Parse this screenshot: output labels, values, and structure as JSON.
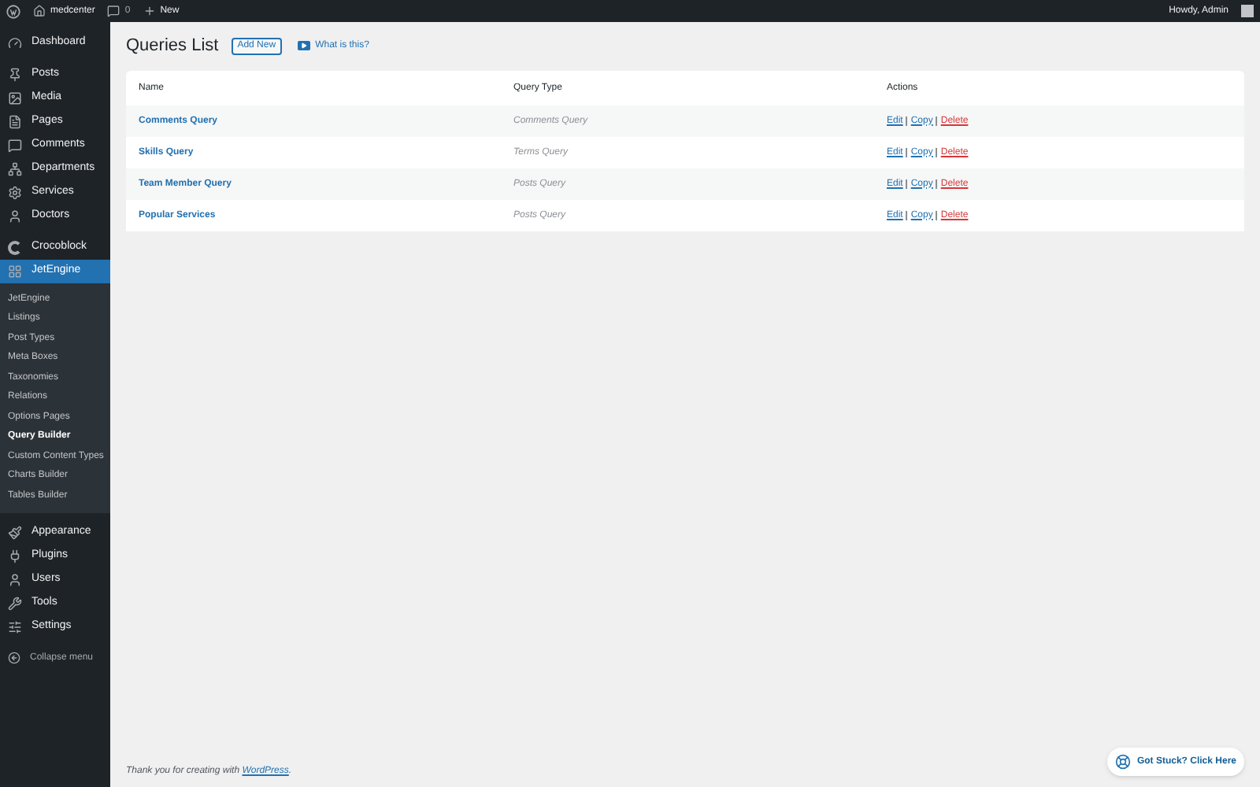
{
  "admin_bar": {
    "site_name": "medcenter",
    "comments_count": "0",
    "new_label": "New",
    "greeting": "Howdy, Admin"
  },
  "sidebar": {
    "groups": [
      [
        {
          "label": "Dashboard",
          "selected": false
        }
      ],
      [
        {
          "label": "Posts",
          "selected": false
        },
        {
          "label": "Media",
          "selected": false
        },
        {
          "label": "Pages",
          "selected": false
        },
        {
          "label": "Comments",
          "selected": false
        },
        {
          "label": "Departments",
          "selected": false
        },
        {
          "label": "Services",
          "selected": false
        },
        {
          "label": "Doctors",
          "selected": false
        }
      ],
      [
        {
          "label": "Crocoblock",
          "selected": false
        },
        {
          "label": "JetEngine",
          "selected": true,
          "children": [
            {
              "label": "JetEngine",
              "selected": false
            },
            {
              "label": "Listings",
              "selected": false
            },
            {
              "label": "Post Types",
              "selected": false
            },
            {
              "label": "Meta Boxes",
              "selected": false
            },
            {
              "label": "Taxonomies",
              "selected": false
            },
            {
              "label": "Relations",
              "selected": false
            },
            {
              "label": "Options Pages",
              "selected": false
            },
            {
              "label": "Query Builder",
              "selected": true
            },
            {
              "label": "Custom Content Types",
              "selected": false
            },
            {
              "label": "Charts Builder",
              "selected": false
            },
            {
              "label": "Tables Builder",
              "selected": false
            }
          ]
        }
      ],
      [
        {
          "label": "Appearance",
          "selected": false
        },
        {
          "label": "Plugins",
          "selected": false
        },
        {
          "label": "Users",
          "selected": false
        },
        {
          "label": "Tools",
          "selected": false
        },
        {
          "label": "Settings",
          "selected": false
        }
      ]
    ],
    "collapse_label": "Collapse menu"
  },
  "page": {
    "title": "Queries List",
    "add_new": "Add New",
    "help_link": "What is this?"
  },
  "table": {
    "columns": [
      "Name",
      "Query Type",
      "Actions"
    ],
    "rows": [
      {
        "name": "Comments Query",
        "type": "Comments Query",
        "actions": [
          {
            "label": "Edit",
            "kind": "normal"
          },
          {
            "label": "Copy",
            "kind": "normal"
          },
          {
            "label": "Delete",
            "kind": "danger"
          }
        ]
      },
      {
        "name": "Skills Query",
        "type": "Terms Query",
        "actions": [
          {
            "label": "Edit",
            "kind": "normal"
          },
          {
            "label": "Copy",
            "kind": "normal"
          },
          {
            "label": "Delete",
            "kind": "danger"
          }
        ]
      },
      {
        "name": "Team Member Query",
        "type": "Posts Query",
        "actions": [
          {
            "label": "Edit",
            "kind": "normal"
          },
          {
            "label": "Copy",
            "kind": "normal"
          },
          {
            "label": "Delete",
            "kind": "danger"
          }
        ]
      },
      {
        "name": "Popular Services",
        "type": "Posts Query",
        "actions": [
          {
            "label": "Edit",
            "kind": "normal"
          },
          {
            "label": "Copy",
            "kind": "normal"
          },
          {
            "label": "Delete",
            "kind": "danger"
          }
        ]
      }
    ]
  },
  "footer": {
    "text": "Thank you for creating with",
    "link": "WordPress",
    "end": "."
  },
  "help_button": "Got Stuck? Click Here"
}
